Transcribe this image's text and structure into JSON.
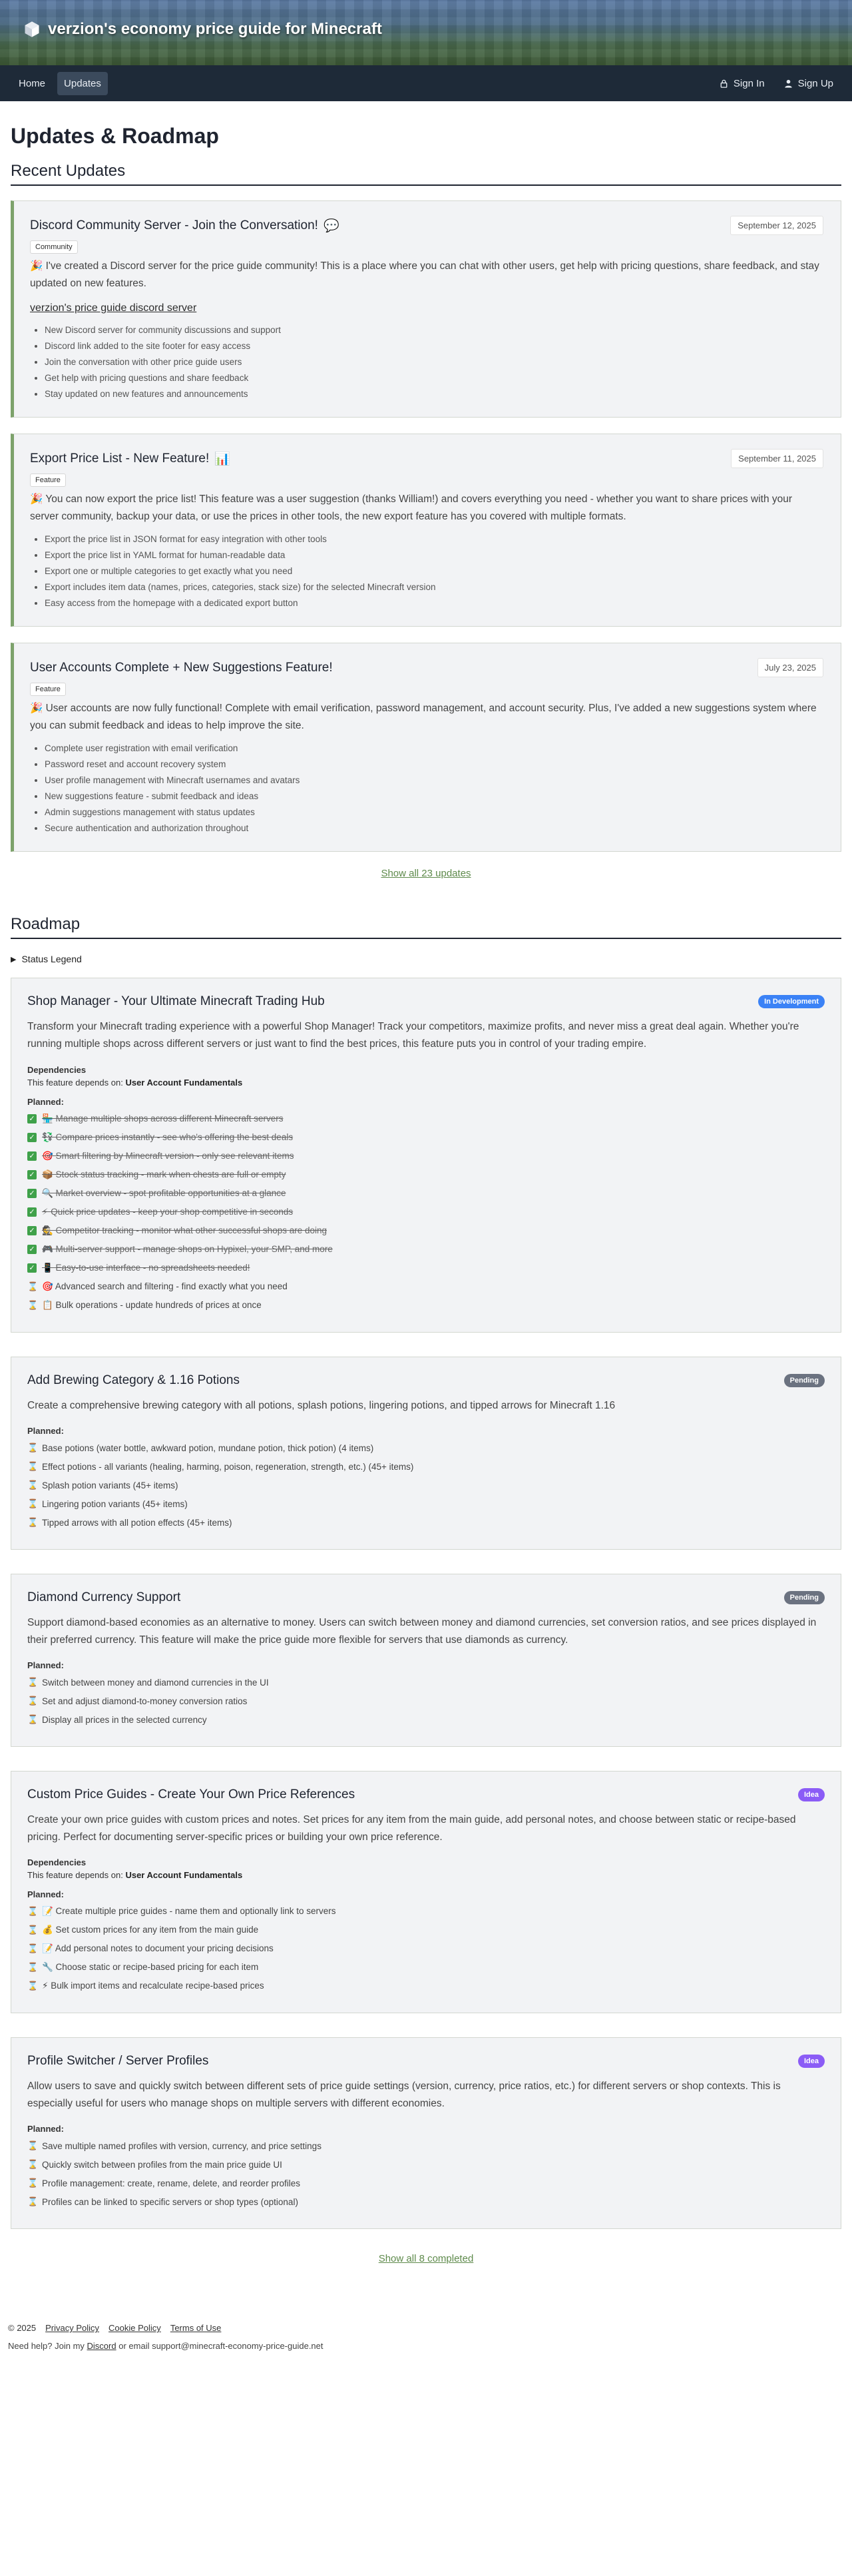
{
  "site": {
    "title": "verzion's economy price guide for Minecraft"
  },
  "nav": {
    "home": "Home",
    "updates": "Updates",
    "sign_in": "Sign In",
    "sign_up": "Sign Up"
  },
  "page": {
    "title": "Updates & Roadmap",
    "recent_updates": "Recent Updates",
    "roadmap": "Roadmap"
  },
  "updates": [
    {
      "title": "Discord Community Server - Join the Conversation!",
      "title_emoji": "💬",
      "date": "September 12, 2025",
      "badge": "Community",
      "description": "🎉 I've created a Discord server for the price guide community! This is a place where you can chat with other users, get help with pricing questions, share feedback, and stay updated on new features.",
      "link": "verzion's price guide discord server",
      "items": [
        "New Discord server for community discussions and support",
        "Discord link added to the site footer for easy access",
        "Join the conversation with other price guide users",
        "Get help with pricing questions and share feedback",
        "Stay updated on new features and announcements"
      ]
    },
    {
      "title": "Export Price List - New Feature!",
      "title_emoji": "📊",
      "date": "September 11, 2025",
      "badge": "Feature",
      "description": "🎉 You can now export the price list! This feature was a user suggestion (thanks William!) and covers everything you need - whether you want to share prices with your server community, backup your data, or use the prices in other tools, the new export feature has you covered with multiple formats.",
      "link": "",
      "items": [
        "Export the price list in JSON format for easy integration with other tools",
        "Export the price list in YAML format for human-readable data",
        "Export one or multiple categories to get exactly what you need",
        "Export includes item data (names, prices, categories, stack size) for the selected Minecraft version",
        "Easy access from the homepage with a dedicated export button"
      ]
    },
    {
      "title": "User Accounts Complete + New Suggestions Feature!",
      "title_emoji": "",
      "date": "July 23, 2025",
      "badge": "Feature",
      "description": "🎉 User accounts are now fully functional! Complete with email verification, password management, and account security. Plus, I've added a new suggestions system where you can submit feedback and ideas to help improve the site.",
      "link": "",
      "items": [
        "Complete user registration with email verification",
        "Password reset and account recovery system",
        "User profile management with Minecraft usernames and avatars",
        "New suggestions feature - submit feedback and ideas",
        "Admin suggestions management with status updates",
        "Secure authentication and authorization throughout"
      ]
    }
  ],
  "show_all_updates": "Show all 23 updates",
  "status_legend": "Status Legend",
  "roadmap_items": [
    {
      "title": "Shop Manager - Your Ultimate Minecraft Trading Hub",
      "status": "In Development",
      "status_color": "#3b82f6",
      "description": "Transform your Minecraft trading experience with a powerful Shop Manager! Track your competitors, maximize profits, and never miss a great deal again. Whether you're running multiple shops across different servers or just want to find the best prices, this feature puts you in control of your trading empire.",
      "dependencies_label": "Dependencies",
      "depends_prefix": "This feature depends on:",
      "depends_on": "User Account Fundamentals",
      "planned_label": "Planned:",
      "tasks": [
        {
          "text": "🏪 Manage multiple shops across different Minecraft servers",
          "done": true
        },
        {
          "text": "💱 Compare prices instantly - see who's offering the best deals",
          "done": true
        },
        {
          "text": "🎯 Smart filtering by Minecraft version - only see relevant items",
          "done": true
        },
        {
          "text": "📦 Stock status tracking - mark when chests are full or empty",
          "done": true
        },
        {
          "text": "🔍 Market overview - spot profitable opportunities at a glance",
          "done": true
        },
        {
          "text": "⚡ Quick price updates - keep your shop competitive in seconds",
          "done": true
        },
        {
          "text": "🕵️ Competitor tracking - monitor what other successful shops are doing",
          "done": true
        },
        {
          "text": "🎮 Multi-server support - manage shops on Hypixel, your SMP, and more",
          "done": true
        },
        {
          "text": "📱 Easy-to-use interface - no spreadsheets needed!",
          "done": true
        },
        {
          "text": "🎯 Advanced search and filtering - find exactly what you need",
          "done": false
        },
        {
          "text": "📋 Bulk operations - update hundreds of prices at once",
          "done": false
        }
      ]
    },
    {
      "title": "Add Brewing Category & 1.16 Potions",
      "status": "Pending",
      "status_color": "#6b7280",
      "description": "Create a comprehensive brewing category with all potions, splash potions, lingering potions, and tipped arrows for Minecraft 1.16",
      "dependencies_label": "",
      "depends_prefix": "",
      "depends_on": "",
      "planned_label": "Planned:",
      "tasks": [
        {
          "text": "Base potions (water bottle, awkward potion, mundane potion, thick potion) (4 items)",
          "done": false
        },
        {
          "text": "Effect potions - all variants (healing, harming, poison, regeneration, strength, etc.) (45+ items)",
          "done": false
        },
        {
          "text": "Splash potion variants (45+ items)",
          "done": false
        },
        {
          "text": "Lingering potion variants (45+ items)",
          "done": false
        },
        {
          "text": "Tipped arrows with all potion effects (45+ items)",
          "done": false
        }
      ]
    },
    {
      "title": "Diamond Currency Support",
      "status": "Pending",
      "status_color": "#6b7280",
      "description": "Support diamond-based economies as an alternative to money. Users can switch between money and diamond currencies, set conversion ratios, and see prices displayed in their preferred currency. This feature will make the price guide more flexible for servers that use diamonds as currency.",
      "dependencies_label": "",
      "depends_prefix": "",
      "depends_on": "",
      "planned_label": "Planned:",
      "tasks": [
        {
          "text": "Switch between money and diamond currencies in the UI",
          "done": false
        },
        {
          "text": "Set and adjust diamond-to-money conversion ratios",
          "done": false
        },
        {
          "text": "Display all prices in the selected currency",
          "done": false
        }
      ]
    },
    {
      "title": "Custom Price Guides - Create Your Own Price References",
      "status": "Idea",
      "status_color": "#8b5cf6",
      "description": "Create your own price guides with custom prices and notes. Set prices for any item from the main guide, add personal notes, and choose between static or recipe-based pricing. Perfect for documenting server-specific prices or building your own price reference.",
      "dependencies_label": "Dependencies",
      "depends_prefix": "This feature depends on:",
      "depends_on": "User Account Fundamentals",
      "planned_label": "Planned:",
      "tasks": [
        {
          "text": "📝 Create multiple price guides - name them and optionally link to servers",
          "done": false
        },
        {
          "text": "💰 Set custom prices for any item from the main guide",
          "done": false
        },
        {
          "text": "📝 Add personal notes to document your pricing decisions",
          "done": false
        },
        {
          "text": "🔧 Choose static or recipe-based pricing for each item",
          "done": false
        },
        {
          "text": "⚡ Bulk import items and recalculate recipe-based prices",
          "done": false
        }
      ]
    },
    {
      "title": "Profile Switcher / Server Profiles",
      "status": "Idea",
      "status_color": "#8b5cf6",
      "description": "Allow users to save and quickly switch between different sets of price guide settings (version, currency, price ratios, etc.) for different servers or shop contexts. This is especially useful for users who manage shops on multiple servers with different economies.",
      "dependencies_label": "",
      "depends_prefix": "",
      "depends_on": "",
      "planned_label": "Planned:",
      "tasks": [
        {
          "text": "Save multiple named profiles with version, currency, and price settings",
          "done": false
        },
        {
          "text": "Quickly switch between profiles from the main price guide UI",
          "done": false
        },
        {
          "text": "Profile management: create, rename, delete, and reorder profiles",
          "done": false
        },
        {
          "text": "Profiles can be linked to specific servers or shop types (optional)",
          "done": false
        }
      ]
    }
  ],
  "show_completed": "Show all 8 completed",
  "footer": {
    "copyright": "© 2025",
    "privacy": "Privacy Policy",
    "cookie": "Cookie Policy",
    "terms": "Terms of Use",
    "help_prefix": "Need help? Join my",
    "discord": "Discord",
    "help_suffix": "or email support@minecraft-economy-price-guide.net"
  },
  "colors": {
    "accent_green": "#7da26b",
    "nav_bg": "#1e2a38",
    "done_green": "#3fa14a"
  },
  "icons": {
    "logo": "cube-icon",
    "sign_in": "lock-icon",
    "sign_up": "user-icon",
    "done": "checkbox-icon",
    "pending": "hourglass-icon"
  }
}
